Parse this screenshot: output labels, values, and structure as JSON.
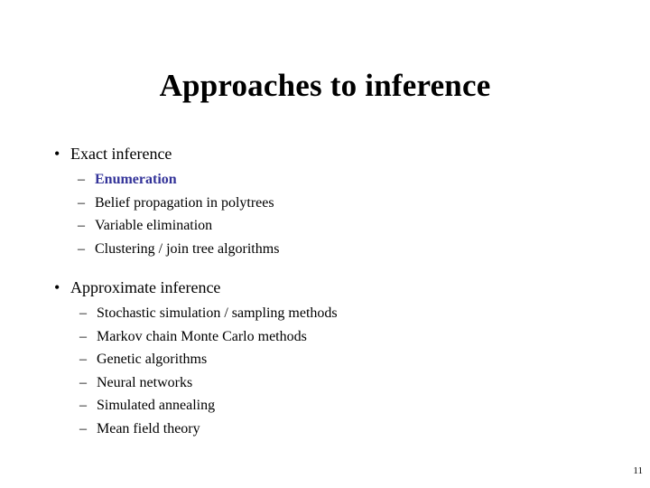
{
  "slide": {
    "title": "Approaches to inference",
    "page_number": "11",
    "accent_color": "#333399",
    "background_color": "#ffffff",
    "text_color": "#000000",
    "bullet_glyphs": {
      "level1": "•",
      "level2": "–"
    },
    "groups": [
      {
        "heading": "Exact inference",
        "items": [
          {
            "text": "Enumeration",
            "emphasis": true
          },
          {
            "text": "Belief propagation in polytrees",
            "emphasis": false
          },
          {
            "text": "Variable elimination",
            "emphasis": false
          },
          {
            "text": "Clustering / join tree algorithms",
            "emphasis": false
          }
        ]
      },
      {
        "heading": "Approximate inference",
        "items": [
          {
            "text": "Stochastic simulation / sampling methods",
            "emphasis": false
          },
          {
            "text": "Markov chain Monte Carlo methods",
            "emphasis": false
          },
          {
            "text": "Genetic algorithms",
            "emphasis": false
          },
          {
            "text": "Neural networks",
            "emphasis": false
          },
          {
            "text": "Simulated annealing",
            "emphasis": false
          },
          {
            "text": "Mean field theory",
            "emphasis": false
          }
        ]
      }
    ]
  }
}
